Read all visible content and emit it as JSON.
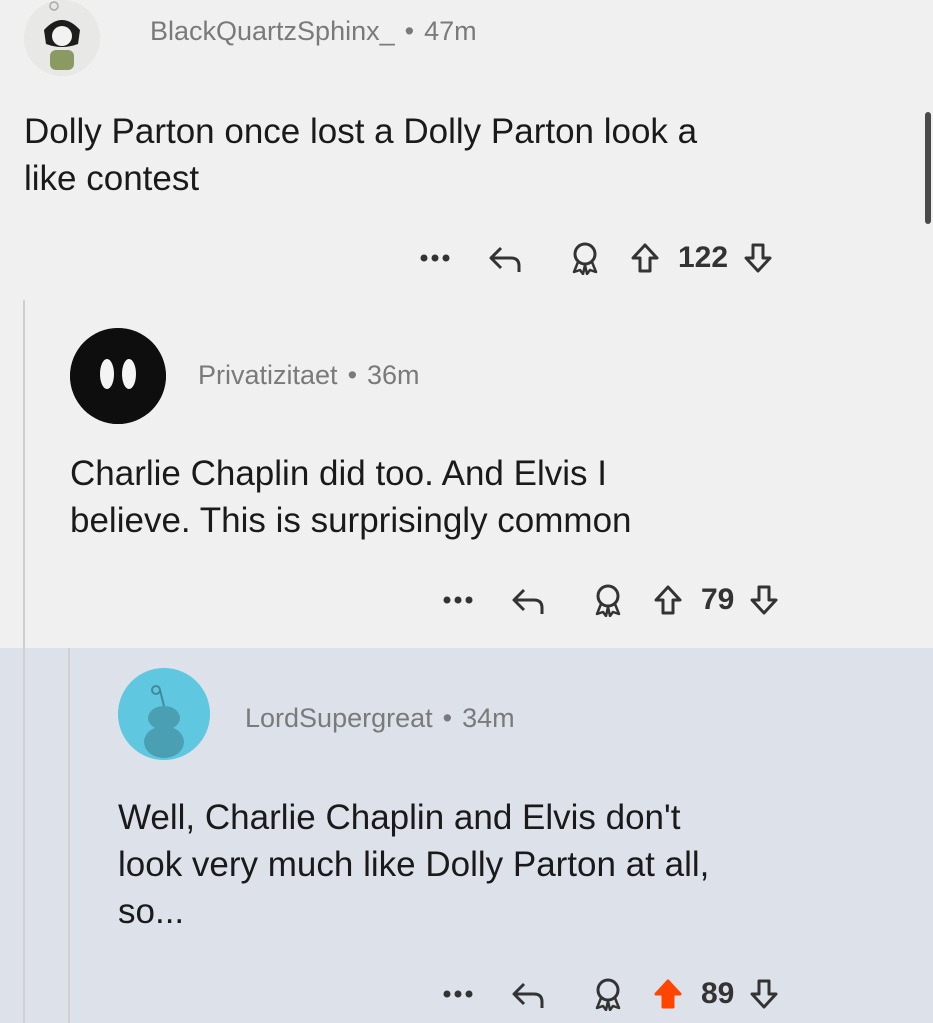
{
  "comments": [
    {
      "username": "BlackQuartzSphinx_",
      "time": "47m",
      "text_lines": [
        "Dolly Parton once lost a Dolly Parton look a",
        "like contest"
      ],
      "votes": "122",
      "upvoted": false
    },
    {
      "username": "Privatizitaet",
      "time": "36m",
      "text_lines": [
        "Charlie Chaplin did too. And Elvis I",
        "believe. This is surprisingly common"
      ],
      "votes": "79",
      "upvoted": false
    },
    {
      "username": "LordSupergreat",
      "time": "34m",
      "text_lines": [
        "Well, Charlie Chaplin and Elvis don't",
        "look very much like Dolly Parton at all,",
        "so..."
      ],
      "votes": "89",
      "upvoted": true
    }
  ],
  "separator": "•",
  "colors": {
    "upvote_active": "#ff4500",
    "highlight_bg": "#dde1ea",
    "snoo_avatar_bg": "#5fc8e0"
  },
  "icons": {
    "more": "more-icon",
    "reply": "reply-icon",
    "award": "award-icon",
    "upvote": "upvote-arrow-icon",
    "downvote": "downvote-arrow-icon"
  }
}
